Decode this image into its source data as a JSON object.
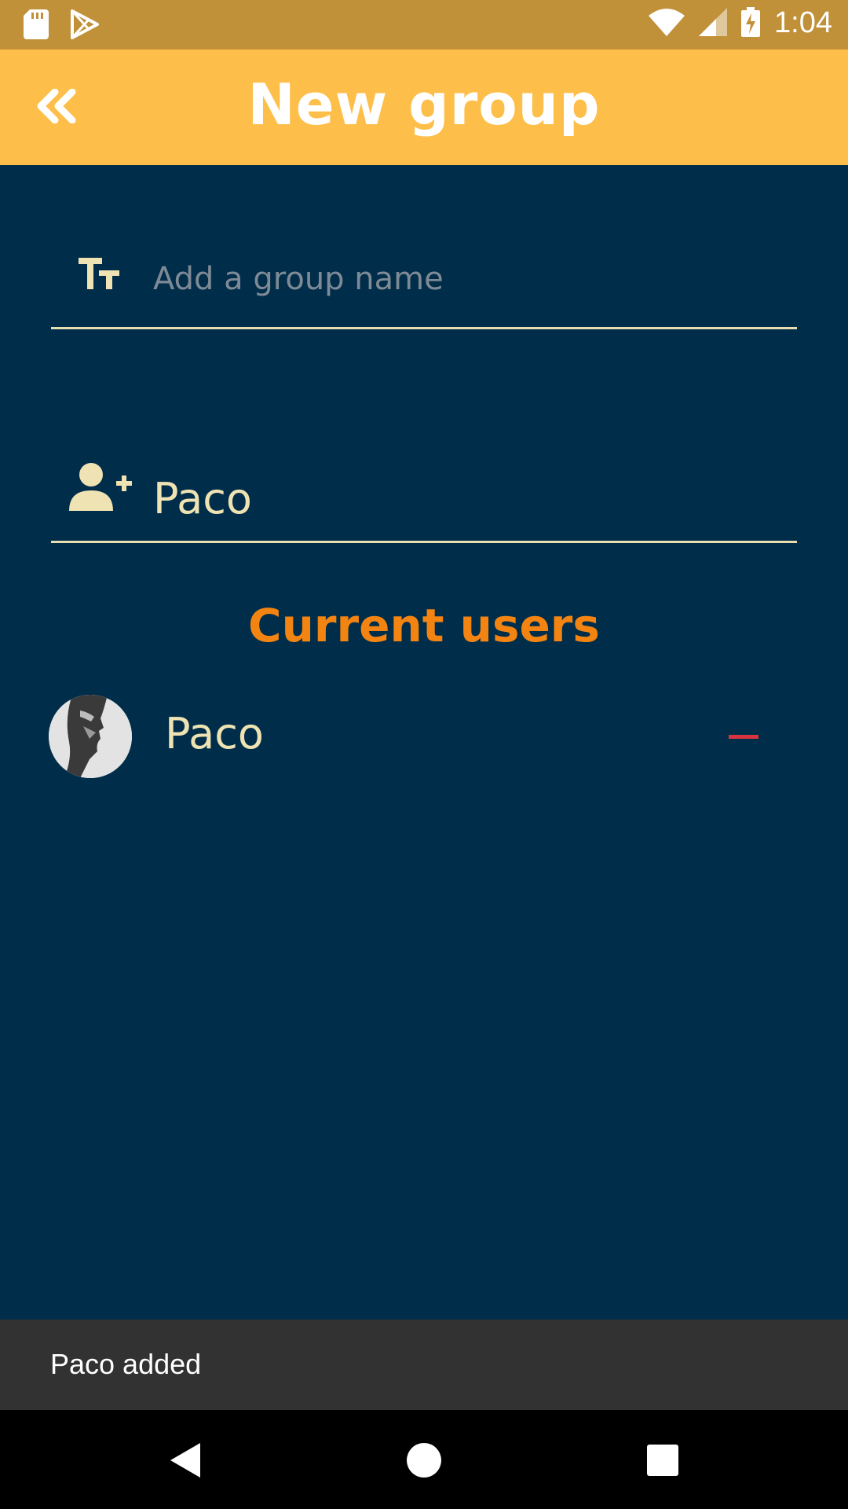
{
  "status_bar": {
    "time": "1:04",
    "icons": [
      "sd-card-icon",
      "play-store-icon",
      "wifi-icon",
      "signal-icon",
      "battery-charging-icon"
    ]
  },
  "app_bar": {
    "title": "New group",
    "back_icon": "double-chevron-left-icon"
  },
  "group_name_field": {
    "icon": "text-size-icon",
    "placeholder": "Add a group name",
    "value": ""
  },
  "add_user_field": {
    "icon": "user-plus-icon",
    "value": "Paco"
  },
  "current_users": {
    "title": "Current users",
    "users": [
      {
        "name": "Paco",
        "remove_icon": "minus-icon"
      }
    ]
  },
  "snackbar": {
    "message": "Paco added"
  },
  "nav_bar": {
    "buttons": [
      "back-triangle-icon",
      "home-circle-icon",
      "recents-square-icon"
    ]
  },
  "colors": {
    "status_bar": "#c1913a",
    "app_bar": "#fdbf4a",
    "background": "#002e4a",
    "accent_orange": "#f48412",
    "text_cream": "#efe3b3",
    "remove_red": "#d8343f"
  }
}
